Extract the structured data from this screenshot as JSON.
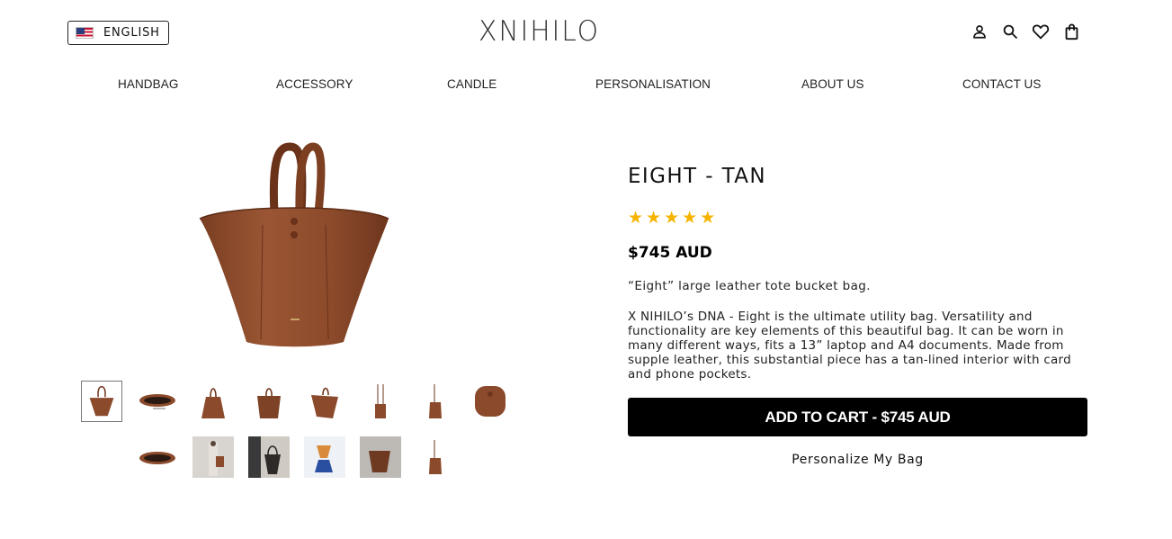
{
  "header": {
    "language_label": "ENGLISH",
    "language_flag_icon": "us-flag-icon",
    "logo_text": "XNIHILO",
    "icons": [
      "user-icon",
      "search-icon",
      "heart-icon",
      "bag-icon"
    ]
  },
  "nav": {
    "items": [
      {
        "label": "HANDBAG"
      },
      {
        "label": "ACCESSORY"
      },
      {
        "label": "CANDLE"
      },
      {
        "label": "PERSONALISATION"
      },
      {
        "label": "ABOUT US"
      },
      {
        "label": "CONTACT US"
      }
    ]
  },
  "product": {
    "title": "EIGHT - TAN",
    "rating": 5,
    "rating_max": 5,
    "price": "$745 AUD",
    "short_description": "“Eight” large leather tote bucket bag.",
    "description": "X NIHILO’s DNA - Eight is the ultimate utility bag. Versatility and functionality are key elements of this beautiful bag. It can be worn in many different ways, fits a 13” laptop and A4 documents. Made from supple leather, this substantial piece has a tan-lined interior with card and phone pockets.",
    "add_to_cart_label": "ADD TO CART - $745 AUD",
    "personalize_label": "Personalize My Bag",
    "image_alt": "tan leather tote bucket bag"
  },
  "thumbnails": {
    "count": 14,
    "selected_index": 0
  },
  "colors": {
    "leather": "#8b4a2b",
    "accent_star": "#f4b400",
    "button_bg": "#000000"
  }
}
